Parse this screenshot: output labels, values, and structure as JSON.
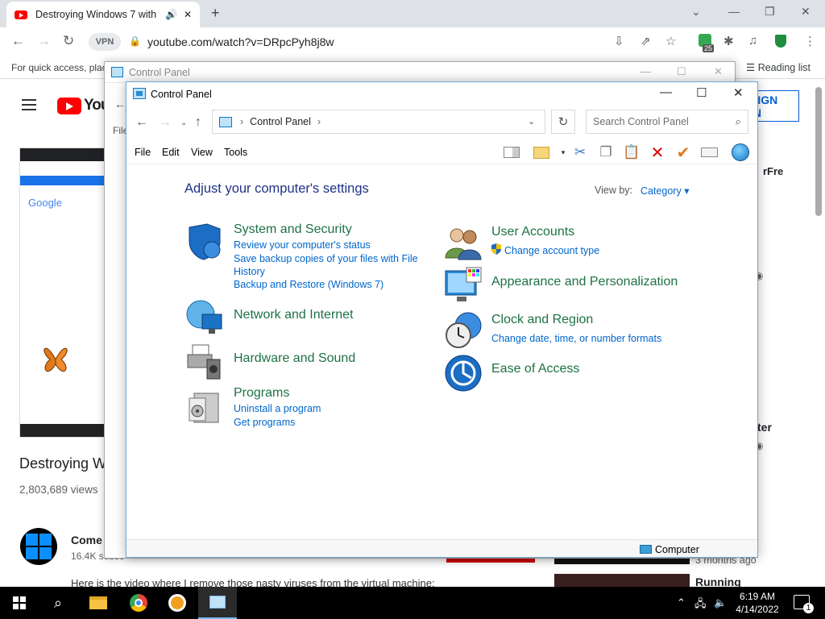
{
  "browser": {
    "tab_title": "Destroying Windows 7 with",
    "url": "youtube.com/watch?v=DRpcPyh8j8w",
    "vpn_label": "VPN",
    "bookmarks_text": "For quick access, plac",
    "reading_list": "Reading list",
    "ext_badge": "25"
  },
  "youtube": {
    "logo_text": "You",
    "sign_in": "SIGN IN",
    "video_title": "Destroying W",
    "views": "2,803,689 views",
    "channel": "Come on W",
    "subs": "16.4K subsc",
    "description": "Here is the video where I remove those nasty viruses from the virtual machine:",
    "right_text1": "rFre",
    "right_footer1": "3 months ago",
    "right_footer2": "Running",
    "right_frag_ter": "ter",
    "video_google": "Google"
  },
  "back_window": {
    "title": "Control Panel",
    "fragment": "File"
  },
  "control_panel": {
    "title": "Control Panel",
    "breadcrumb": "Control Panel",
    "search_placeholder": "Search Control Panel",
    "menu": [
      "File",
      "Edit",
      "View",
      "Tools"
    ],
    "heading": "Adjust your computer's settings",
    "view_by_label": "View by:",
    "view_by_value": "Category",
    "categories_left": [
      {
        "title": "System and Security",
        "links": [
          "Review your computer's status",
          "Save backup copies of your files with File History",
          "Backup and Restore (Windows 7)"
        ],
        "icon": "shield-icon"
      },
      {
        "title": "Network and Internet",
        "links": [],
        "icon": "network-globe-icon"
      },
      {
        "title": "Hardware and Sound",
        "links": [],
        "icon": "printer-icon"
      },
      {
        "title": "Programs",
        "links": [
          "Uninstall a program",
          "Get programs"
        ],
        "icon": "programs-box-icon"
      }
    ],
    "categories_right": [
      {
        "title": "User Accounts",
        "links": [
          "Change account type"
        ],
        "icon": "users-icon"
      },
      {
        "title": "Appearance and Personalization",
        "links": [],
        "icon": "monitor-palette-icon"
      },
      {
        "title": "Clock and Region",
        "links": [
          "Change date, time, or number formats"
        ],
        "icon": "clock-globe-icon"
      },
      {
        "title": "Ease of Access",
        "links": [],
        "icon": "ease-of-access-icon"
      }
    ],
    "status": "Computer"
  },
  "taskbar": {
    "time": "6:19 AM",
    "date": "4/14/2022",
    "notif_count": "1"
  },
  "colors": {
    "category_green": "#1e7145",
    "link_blue": "#0066cc",
    "heading_blue": "#1e3287"
  }
}
